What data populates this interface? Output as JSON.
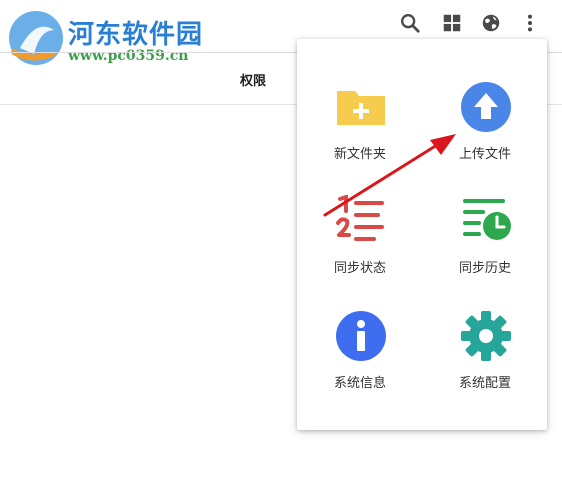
{
  "watermark": {
    "title": "河东软件园",
    "url": "www.pc0359.cn"
  },
  "table": {
    "permission_header": "权限"
  },
  "toolbar": {
    "icons": [
      "search-icon",
      "grid-icon",
      "globe-icon",
      "more-vert-icon"
    ],
    "icon_color": "#4a4a4a"
  },
  "menu": {
    "items": [
      {
        "label": "新文件夹",
        "icon": "folder-plus-icon",
        "color": "#f6cc4f"
      },
      {
        "label": "上传文件",
        "icon": "upload-icon",
        "color": "#4a86e8"
      },
      {
        "label": "同步状态",
        "icon": "sync-status-icon",
        "color": "#d84a45"
      },
      {
        "label": "同步历史",
        "icon": "sync-history-icon",
        "color": "#2ea84f"
      },
      {
        "label": "系统信息",
        "icon": "info-icon",
        "color": "#3f6df0"
      },
      {
        "label": "系统配置",
        "icon": "gear-icon",
        "color": "#26a69a"
      }
    ]
  },
  "annotation": {
    "arrow_color": "#d9161c"
  }
}
